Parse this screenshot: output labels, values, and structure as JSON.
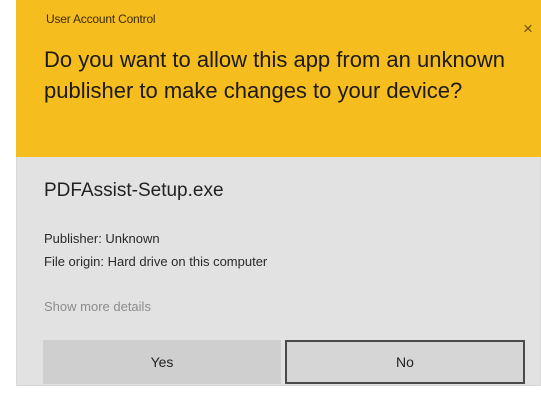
{
  "window": {
    "title": "User Account Control",
    "close_glyph": "×"
  },
  "prompt": {
    "question": "Do you want to allow this app from an unknown publisher to make changes to your device?"
  },
  "app": {
    "name": "PDFAssist-Setup.exe",
    "publisher_line": "Publisher: Unknown",
    "origin_line": "File origin: Hard drive on this computer"
  },
  "links": {
    "show_more": "Show more details"
  },
  "buttons": {
    "yes": "Yes",
    "no": "No"
  },
  "colors": {
    "header_background": "#f5be1e",
    "body_background": "#e2e2e2",
    "link_text": "#8c8c8c"
  }
}
